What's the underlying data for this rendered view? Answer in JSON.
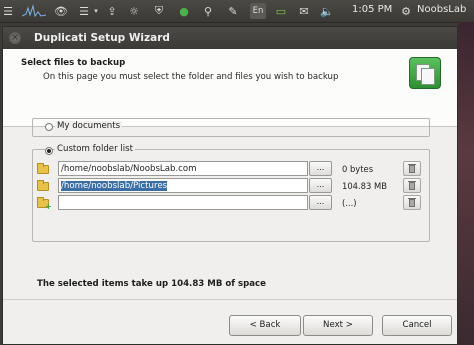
{
  "panel": {
    "language": "En",
    "clock": "1:05 PM",
    "user": "NoobsLab"
  },
  "window": {
    "title": "Duplicati Setup Wizard",
    "close_glyph": "×"
  },
  "header": {
    "title": "Select files to backup",
    "description": "On this page you must select the folder and files you wish to backup"
  },
  "options": {
    "my_documents": "My documents",
    "custom_folder_list": "Custom folder list",
    "selected": "custom_folder_list"
  },
  "folders": [
    {
      "path": "/home/noobslab/NoobsLab.com",
      "size": "0 bytes",
      "selected": false
    },
    {
      "path": "/home/noobslab/Pictures",
      "size": "104.83 MB",
      "selected": true
    },
    {
      "path": "",
      "size": "(...)",
      "selected": false
    }
  ],
  "browse_label": "...",
  "summary": "The selected items take up 104.83 MB of space",
  "buttons": {
    "back": "< Back",
    "next": "Next >",
    "cancel": "Cancel"
  },
  "colors": {
    "selection": "#3b6ea5",
    "logo_green": "#3aa13a",
    "panel_bg": "#3c3b37"
  }
}
